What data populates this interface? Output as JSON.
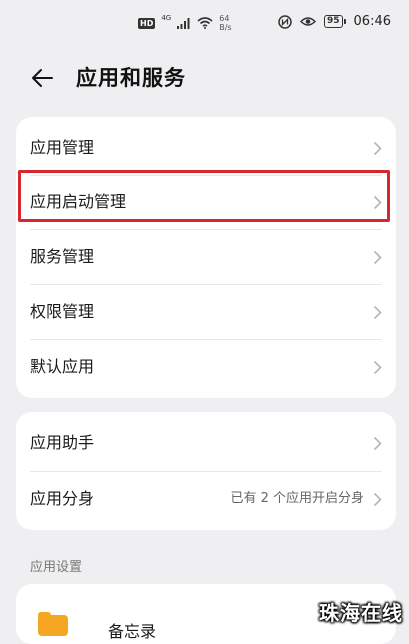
{
  "status_bar": {
    "hd_badge": "HD",
    "network_tag": "4G",
    "speed_value": "64",
    "speed_unit": "B/s",
    "battery": "95",
    "time": "06:46"
  },
  "header": {
    "title": "应用和服务"
  },
  "group1": {
    "items": [
      {
        "label": "应用管理"
      },
      {
        "label": "应用启动管理"
      },
      {
        "label": "服务管理"
      },
      {
        "label": "权限管理"
      },
      {
        "label": "默认应用"
      }
    ]
  },
  "group2": {
    "items": [
      {
        "label": "应用助手",
        "value": ""
      },
      {
        "label": "应用分身",
        "value": "已有 2 个应用开启分身"
      }
    ]
  },
  "section": {
    "label": "应用设置"
  },
  "group3": {
    "partial_label": "备忘录"
  },
  "watermark": "珠海在线",
  "colors": {
    "background": "#efeff1",
    "card": "#ffffff",
    "highlight_border": "#d9252c",
    "folder_icon": "#f5a623"
  }
}
